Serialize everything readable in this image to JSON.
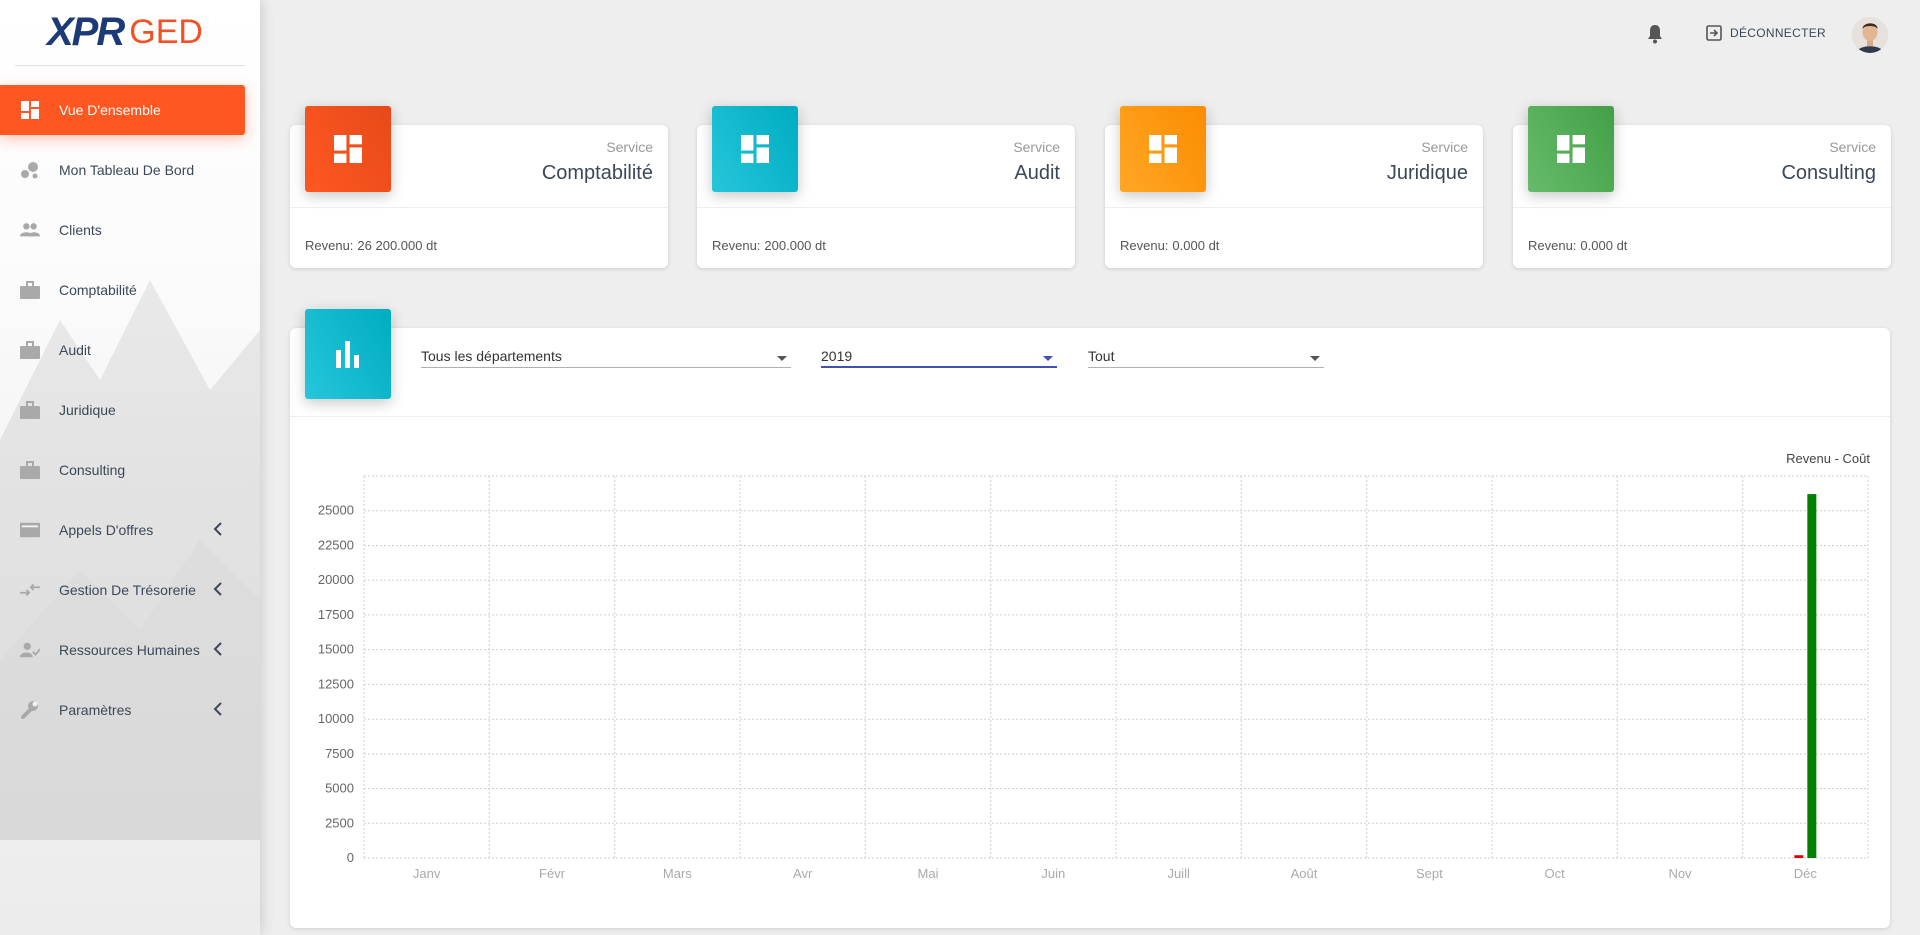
{
  "brand": {
    "part1": "XPR",
    "part2": "GED"
  },
  "sidebar": {
    "items": [
      {
        "label": "Vue D'ensemble",
        "icon": "dashboard-icon",
        "active": true
      },
      {
        "label": "Mon Tableau De Bord",
        "icon": "bubble-chart-icon"
      },
      {
        "label": "Clients",
        "icon": "people-icon"
      },
      {
        "label": "Comptabilité",
        "icon": "briefcase-icon"
      },
      {
        "label": "Audit",
        "icon": "briefcase-icon"
      },
      {
        "label": "Juridique",
        "icon": "briefcase-icon"
      },
      {
        "label": "Consulting",
        "icon": "briefcase-icon"
      },
      {
        "label": "Appels D'offres",
        "icon": "card-icon",
        "expandable": true
      },
      {
        "label": "Gestion De Trésorerie",
        "icon": "swap-arrows-icon",
        "expandable": true
      },
      {
        "label": "Ressources Humaines",
        "icon": "person-check-icon",
        "expandable": true
      },
      {
        "label": "Paramètres",
        "icon": "wrench-icon",
        "expandable": true
      }
    ]
  },
  "topbar": {
    "logout_label": "DÉCONNECTER"
  },
  "stats": [
    {
      "category": "Service",
      "title": "Comptabilité",
      "revenue_label": "Revenu:",
      "revenue_value": "26 200.000 dt",
      "color": "#f4511e"
    },
    {
      "category": "Service",
      "title": "Audit",
      "revenue_label": "Revenu:",
      "revenue_value": "200.000 dt",
      "color": "#00acc1"
    },
    {
      "category": "Service",
      "title": "Juridique",
      "revenue_label": "Revenu:",
      "revenue_value": "0.000 dt",
      "color": "#fb8c00"
    },
    {
      "category": "Service",
      "title": "Consulting",
      "revenue_label": "Revenu:",
      "revenue_value": "0.000 dt",
      "color": "#43a047"
    }
  ],
  "filters": {
    "department": "Tous les départements",
    "year": "2019",
    "type": "Tout"
  },
  "chart_data": {
    "type": "bar",
    "title": "",
    "legend": "Revenu - Coût",
    "categories": [
      "Janv",
      "Févr",
      "Mars",
      "Avr",
      "Mai",
      "Juin",
      "Juill",
      "Août",
      "Sept",
      "Oct",
      "Nov",
      "Déc"
    ],
    "series": [
      {
        "values": [
          0,
          0,
          0,
          0,
          0,
          0,
          0,
          0,
          0,
          0,
          0,
          200
        ],
        "color": "#e00000"
      },
      {
        "values": [
          0,
          0,
          0,
          0,
          0,
          0,
          0,
          0,
          0,
          0,
          0,
          26200
        ],
        "color": "#008000"
      }
    ],
    "yticks": [
      0,
      2500,
      5000,
      7500,
      10000,
      12500,
      15000,
      17500,
      20000,
      22500,
      25000
    ],
    "ylim": [
      0,
      27500
    ],
    "grid": true
  }
}
